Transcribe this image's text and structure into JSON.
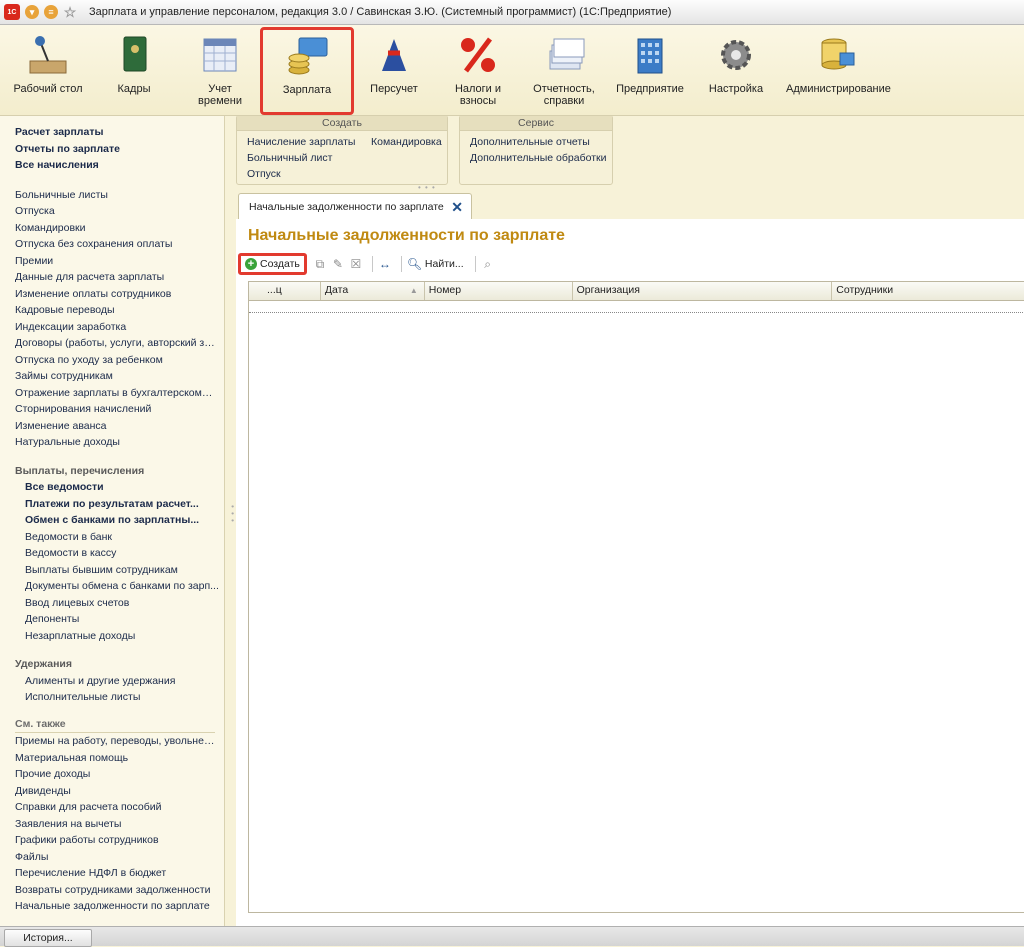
{
  "window": {
    "title": "Зарплата и управление персоналом, редакция 3.0 / Савинская З.Ю. (Системный программист)  (1С:Предприятие)",
    "logo_text": "1С"
  },
  "sections": [
    {
      "label": "Рабочий стол",
      "icon": "desk-lamp-icon"
    },
    {
      "label": "Кадры",
      "icon": "personnel-book-icon"
    },
    {
      "label": "Учет времени",
      "icon": "calendar-icon"
    },
    {
      "label": "Зарплата",
      "icon": "coins-card-icon"
    },
    {
      "label": "Персучет",
      "icon": "pension-fund-icon"
    },
    {
      "label": "Налоги и взносы",
      "icon": "percent-icon"
    },
    {
      "label": "Отчетность, справки",
      "icon": "papers-icon"
    },
    {
      "label": "Предприятие",
      "icon": "building-icon"
    },
    {
      "label": "Настройка",
      "icon": "gear-icon"
    },
    {
      "label": "Администрирование",
      "icon": "database-icon"
    }
  ],
  "actions": {
    "create_header": "Создать",
    "create_items": [
      "Начисление зарплаты",
      "Больничный лист",
      "Отпуск",
      "Командировка"
    ],
    "service_header": "Сервис",
    "service_items": [
      "Дополнительные отчеты",
      "Дополнительные обработки"
    ]
  },
  "nav": {
    "top_bold": [
      "Расчет зарплаты",
      "Отчеты по зарплате",
      "Все начисления"
    ],
    "docs": [
      "Больничные листы",
      "Отпуска",
      "Командировки",
      "Отпуска без сохранения оплаты",
      "Премии",
      "Данные для расчета зарплаты",
      "Изменение оплаты сотрудников",
      "Кадровые переводы",
      "Индексации заработка",
      "Договоры (работы, услуги, авторский за...",
      "Отпуска по уходу за ребенком",
      "Займы сотрудникам",
      "Отражение зарплаты в бухгалтерском у...",
      "Сторнирования начислений",
      "Изменение аванса",
      "Натуральные доходы"
    ],
    "payments_group": "Выплаты, перечисления",
    "payments_bold": [
      "Все ведомости",
      "Платежи по результатам расчет...",
      "Обмен с банками по зарплатны..."
    ],
    "payments": [
      "Ведомости в банк",
      "Ведомости в кассу",
      "Выплаты бывшим сотрудникам",
      "Документы обмена с банками по зарп...",
      "Ввод лицевых счетов",
      "Депоненты",
      "Незарплатные доходы"
    ],
    "deductions_group": "Удержания",
    "deductions": [
      "Алименты и другие удержания",
      "Исполнительные листы"
    ],
    "see_also_group": "См. также",
    "see_also": [
      "Приемы на работу, переводы, увольнения",
      "Материальная помощь",
      "Прочие доходы",
      "Дивиденды",
      "Справки для расчета пособий",
      "Заявления на вычеты",
      "Графики работы сотрудников",
      "Файлы",
      "Перечисление НДФЛ в бюджет",
      "Возвраты сотрудниками задолженности",
      "Начальные задолженности по зарплате"
    ]
  },
  "tab": {
    "label": "Начальные задолженности по зарплате",
    "close": "✕"
  },
  "page": {
    "heading": "Начальные задолженности по зарплате",
    "create_button": "Создать",
    "find_button": "Найти...",
    "columns": [
      "...ц",
      "Дата",
      "Номер",
      "Организация",
      "Сотрудники"
    ],
    "sort_indicator": "▲"
  },
  "status": {
    "history_button": "История..."
  },
  "colors": {
    "accent_red": "#e23a2f",
    "heading_gold": "#c08a12",
    "panel_bg": "#f7f2d8"
  }
}
